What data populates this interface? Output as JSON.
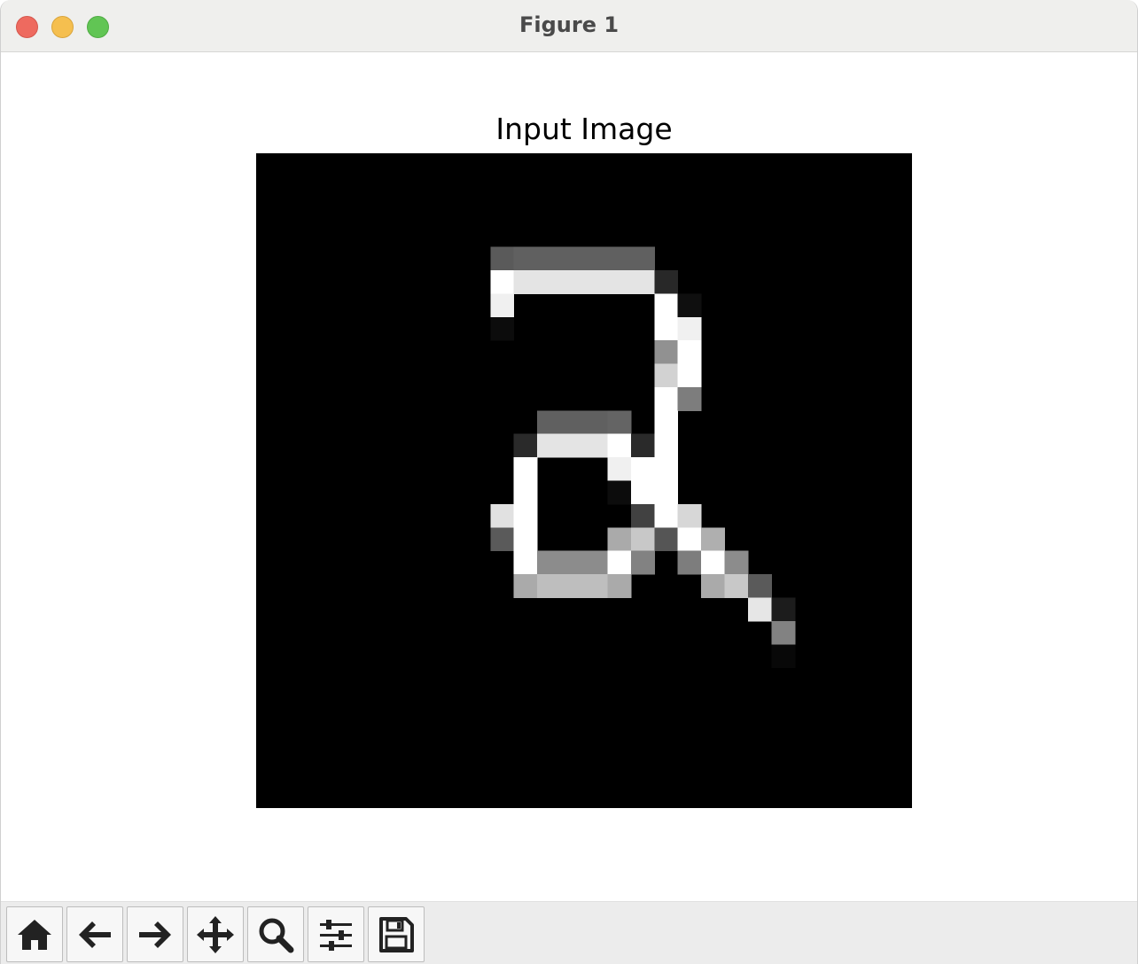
{
  "window": {
    "title": "Figure 1"
  },
  "figure": {
    "axes_title": "Input Image",
    "colormap": "gray",
    "background": "#000000"
  },
  "toolbar": {
    "buttons": [
      {
        "name": "home-button",
        "icon": "home-icon"
      },
      {
        "name": "back-button",
        "icon": "arrow-left-icon"
      },
      {
        "name": "forward-button",
        "icon": "arrow-right-icon"
      },
      {
        "name": "pan-button",
        "icon": "move-icon"
      },
      {
        "name": "zoom-button",
        "icon": "magnifier-icon"
      },
      {
        "name": "configure-subplots-button",
        "icon": "sliders-icon"
      },
      {
        "name": "save-button",
        "icon": "floppy-disk-icon"
      }
    ]
  },
  "chart_data": {
    "type": "heatmap",
    "rows": 28,
    "cols": 28,
    "title": "Input Image",
    "value_range": [
      0,
      255
    ],
    "pixels": [
      {
        "r": 4,
        "c": 10,
        "v": 90
      },
      {
        "r": 4,
        "c": 11,
        "v": 96
      },
      {
        "r": 4,
        "c": 12,
        "v": 96
      },
      {
        "r": 4,
        "c": 13,
        "v": 96
      },
      {
        "r": 4,
        "c": 14,
        "v": 96
      },
      {
        "r": 4,
        "c": 15,
        "v": 96
      },
      {
        "r": 4,
        "c": 16,
        "v": 96
      },
      {
        "r": 5,
        "c": 10,
        "v": 255
      },
      {
        "r": 5,
        "c": 11,
        "v": 228
      },
      {
        "r": 5,
        "c": 12,
        "v": 228
      },
      {
        "r": 5,
        "c": 13,
        "v": 228
      },
      {
        "r": 5,
        "c": 14,
        "v": 228
      },
      {
        "r": 5,
        "c": 15,
        "v": 228
      },
      {
        "r": 5,
        "c": 16,
        "v": 228
      },
      {
        "r": 5,
        "c": 17,
        "v": 40
      },
      {
        "r": 6,
        "c": 10,
        "v": 240
      },
      {
        "r": 6,
        "c": 17,
        "v": 255
      },
      {
        "r": 6,
        "c": 18,
        "v": 15
      },
      {
        "r": 7,
        "c": 10,
        "v": 12
      },
      {
        "r": 7,
        "c": 17,
        "v": 255
      },
      {
        "r": 7,
        "c": 18,
        "v": 240
      },
      {
        "r": 8,
        "c": 17,
        "v": 145
      },
      {
        "r": 8,
        "c": 18,
        "v": 255
      },
      {
        "r": 9,
        "c": 17,
        "v": 210
      },
      {
        "r": 9,
        "c": 18,
        "v": 255
      },
      {
        "r": 10,
        "c": 17,
        "v": 255
      },
      {
        "r": 10,
        "c": 18,
        "v": 125
      },
      {
        "r": 11,
        "c": 12,
        "v": 96
      },
      {
        "r": 11,
        "c": 13,
        "v": 96
      },
      {
        "r": 11,
        "c": 14,
        "v": 96
      },
      {
        "r": 11,
        "c": 15,
        "v": 100
      },
      {
        "r": 11,
        "c": 17,
        "v": 255
      },
      {
        "r": 12,
        "c": 11,
        "v": 42
      },
      {
        "r": 12,
        "c": 12,
        "v": 228
      },
      {
        "r": 12,
        "c": 13,
        "v": 228
      },
      {
        "r": 12,
        "c": 14,
        "v": 228
      },
      {
        "r": 12,
        "c": 15,
        "v": 255
      },
      {
        "r": 12,
        "c": 16,
        "v": 42
      },
      {
        "r": 12,
        "c": 17,
        "v": 255
      },
      {
        "r": 13,
        "c": 11,
        "v": 255
      },
      {
        "r": 13,
        "c": 15,
        "v": 240
      },
      {
        "r": 13,
        "c": 16,
        "v": 255
      },
      {
        "r": 13,
        "c": 17,
        "v": 255
      },
      {
        "r": 14,
        "c": 11,
        "v": 255
      },
      {
        "r": 14,
        "c": 15,
        "v": 12
      },
      {
        "r": 14,
        "c": 16,
        "v": 255
      },
      {
        "r": 14,
        "c": 17,
        "v": 255
      },
      {
        "r": 15,
        "c": 10,
        "v": 225
      },
      {
        "r": 15,
        "c": 11,
        "v": 255
      },
      {
        "r": 15,
        "c": 16,
        "v": 65
      },
      {
        "r": 15,
        "c": 17,
        "v": 255
      },
      {
        "r": 15,
        "c": 18,
        "v": 215
      },
      {
        "r": 16,
        "c": 10,
        "v": 90
      },
      {
        "r": 16,
        "c": 11,
        "v": 255
      },
      {
        "r": 16,
        "c": 15,
        "v": 170
      },
      {
        "r": 16,
        "c": 16,
        "v": 200
      },
      {
        "r": 16,
        "c": 17,
        "v": 85
      },
      {
        "r": 16,
        "c": 18,
        "v": 255
      },
      {
        "r": 16,
        "c": 19,
        "v": 175
      },
      {
        "r": 17,
        "c": 11,
        "v": 255
      },
      {
        "r": 17,
        "c": 12,
        "v": 140
      },
      {
        "r": 17,
        "c": 13,
        "v": 140
      },
      {
        "r": 17,
        "c": 14,
        "v": 140
      },
      {
        "r": 17,
        "c": 15,
        "v": 255
      },
      {
        "r": 17,
        "c": 16,
        "v": 130
      },
      {
        "r": 17,
        "c": 18,
        "v": 125
      },
      {
        "r": 17,
        "c": 19,
        "v": 255
      },
      {
        "r": 17,
        "c": 20,
        "v": 140
      },
      {
        "r": 18,
        "c": 11,
        "v": 170
      },
      {
        "r": 18,
        "c": 12,
        "v": 190
      },
      {
        "r": 18,
        "c": 13,
        "v": 190
      },
      {
        "r": 18,
        "c": 14,
        "v": 190
      },
      {
        "r": 18,
        "c": 15,
        "v": 170
      },
      {
        "r": 18,
        "c": 19,
        "v": 170
      },
      {
        "r": 18,
        "c": 20,
        "v": 200
      },
      {
        "r": 18,
        "c": 21,
        "v": 90
      },
      {
        "r": 19,
        "c": 21,
        "v": 230
      },
      {
        "r": 19,
        "c": 22,
        "v": 28
      },
      {
        "r": 20,
        "c": 22,
        "v": 130
      },
      {
        "r": 21,
        "c": 22,
        "v": 8
      }
    ]
  }
}
